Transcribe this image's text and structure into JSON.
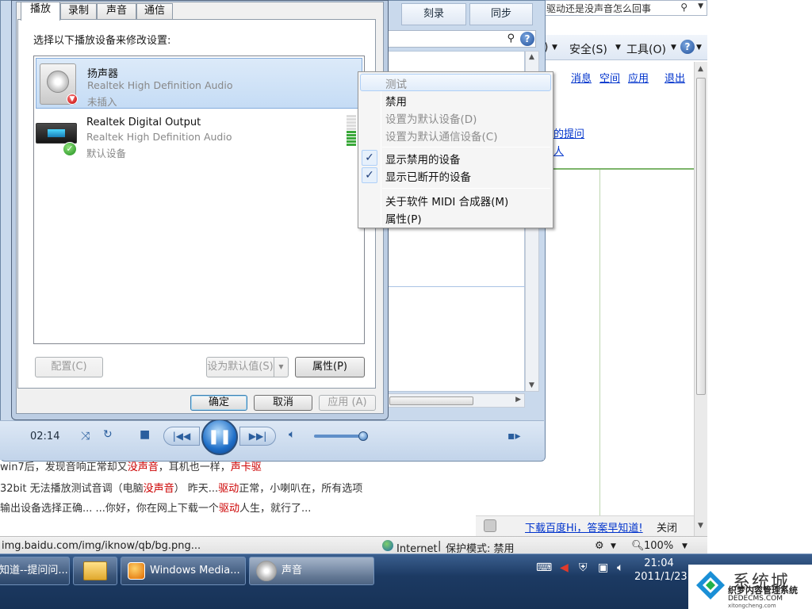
{
  "ie": {
    "search_query": "驱动还是没声音怎么回事",
    "cmdbar": {
      "page_suffix": ")",
      "safety": "安全(S)",
      "tools": "工具(O)"
    },
    "links": {
      "messages": "消息",
      "space": "空间",
      "apps": "应用",
      "logout": "退出",
      "question_fragment": "的提问",
      "fragment2": "人"
    },
    "results": [
      {
        "segments": [
          [
            "win7后，发现音响正常却又",
            ""
          ],
          [
            "没声音",
            "red"
          ],
          [
            "，耳机也一样，",
            ""
          ],
          [
            "声卡驱",
            "red"
          ]
        ]
      },
      {
        "segments": [
          [
            "32bit 无法播放测试音调（电脑",
            ""
          ],
          [
            "没声音",
            "red"
          ],
          [
            "） 昨天...",
            ""
          ],
          [
            "驱动",
            "red"
          ],
          [
            "正常，小喇叭在，所有选项",
            ""
          ]
        ]
      },
      {
        "segments": [
          [
            " 输出设备选择正确... ...你好，你在网上下载一个",
            ""
          ],
          [
            "驱动",
            "red"
          ],
          [
            "人生，就行了...",
            ""
          ]
        ]
      }
    ],
    "notice": {
      "link": "下载百度Hi，答案早知道!",
      "close": "关闭"
    },
    "status": {
      "url": "img.baidu.com/img/iknow/qb/bg.png...",
      "zone": "Internet",
      "protected_mode": "保护模式: 禁用",
      "zoom": "100%"
    }
  },
  "wmp": {
    "tabs": [
      "刻录",
      "同步"
    ],
    "time": "02:14",
    "play_glyph": "❚❚"
  },
  "sound_dialog": {
    "tabs": [
      "播放",
      "录制",
      "声音",
      "通信"
    ],
    "active_tab": "播放",
    "prompt": "选择以下播放设备来修改设置:",
    "devices": [
      {
        "name": "扬声器",
        "driver": "Realtek High Definition Audio",
        "status": "未插入",
        "selected": true
      },
      {
        "name": "Realtek Digital Output",
        "driver": "Realtek High Definition Audio",
        "status": "默认设备",
        "selected": false,
        "meter_level": 0.45
      }
    ],
    "buttons": {
      "configure": "配置(C)",
      "set_default": "设为默认值(S)",
      "properties": "属性(P)",
      "ok": "确定",
      "cancel": "取消",
      "apply": "应用 (A)"
    }
  },
  "context_menu": {
    "items": [
      {
        "label": "测试",
        "enabled": false,
        "highlighted": true
      },
      {
        "label": "禁用",
        "enabled": true
      },
      {
        "label": "设置为默认设备(D)",
        "enabled": false
      },
      {
        "label": "设置为默认通信设备(C)",
        "enabled": false
      },
      {
        "label": "显示禁用的设备",
        "enabled": true,
        "checked": true
      },
      {
        "label": "显示已断开的设备",
        "enabled": true,
        "checked": true
      },
      {
        "label": "关于软件 MIDI 合成器(M)",
        "enabled": true
      },
      {
        "label": "属性(P)",
        "enabled": true
      }
    ]
  },
  "taskbar": {
    "buttons": [
      {
        "label": "知道--提问问...",
        "active": false
      },
      {
        "label": "",
        "active": false
      },
      {
        "label": "Windows Media...",
        "active": false
      },
      {
        "label": "声音",
        "active": true
      }
    ],
    "clock": {
      "time": "21:04",
      "date": "2011/1/23"
    }
  },
  "watermark": {
    "title": "系统城",
    "line1": "织梦内容管理系统",
    "line2": "DEDECMS.COM",
    "line3": "xitongcheng.com"
  },
  "colors": {
    "link": "#0033cc",
    "highlight_red": "#cc0000",
    "taskbar": "#1c3a63",
    "menu_hover": "#e0ecfa"
  }
}
